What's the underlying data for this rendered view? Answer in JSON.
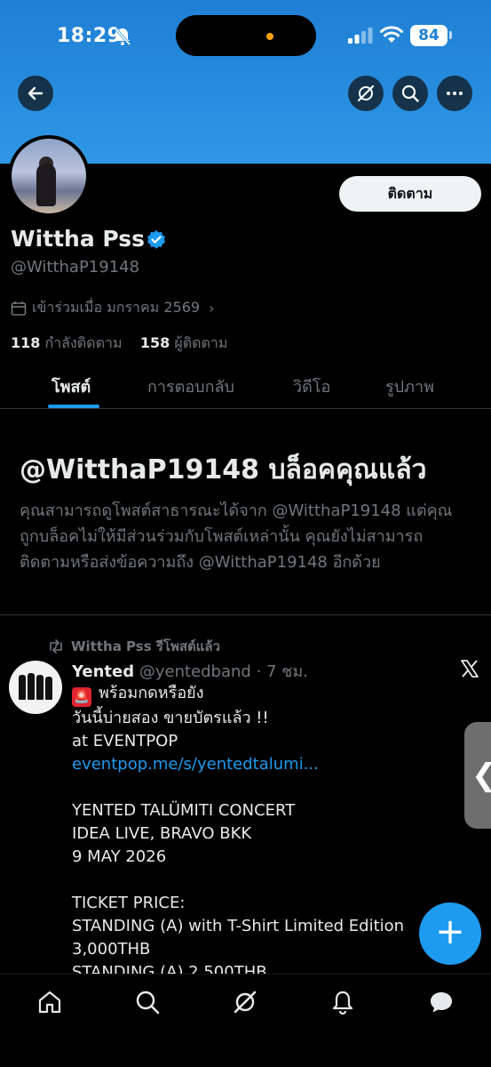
{
  "status_bar": {
    "time": "18:29",
    "battery": "84"
  },
  "profile": {
    "display_name": "Wittha Pss",
    "handle": "@WitthaP19148",
    "joined": "เข้าร่วมเมื่อ มกราคม 2569",
    "following_count": "118",
    "following_label": "กำลังติดตาม",
    "followers_count": "158",
    "followers_label": "ผู้ติดตาม",
    "follow_button": "ติดตาม"
  },
  "tabs": [
    {
      "label": "โพสต์",
      "active": true
    },
    {
      "label": "การตอบกลับ",
      "active": false
    },
    {
      "label": "วิดีโอ",
      "active": false
    },
    {
      "label": "รูปภาพ",
      "active": false
    }
  ],
  "blocked": {
    "title": "@WitthaP19148 บล็อคคุณแล้ว",
    "description": "คุณสามารถดูโพสต์สาธารณะได้จาก @WitthaP19148 แต่คุณถูกบล็อคไม่ให้มีส่วนร่วมกับโพสต์เหล่านั้น คุณยังไม่สามารถติดตามหรือส่งข้อความถึง @WitthaP19148 อีกด้วย"
  },
  "post": {
    "repost_label": "Wittha Pss รีโพสต์แล้ว",
    "author_name": "Yented",
    "author_handle": "@yentedband",
    "time": "· 7 ชม.",
    "lines": [
      "พร้อมกดหรือยัง",
      "วันนี้บ่ายสอง  ขายบัตรแล้ว !!",
      "at EVENTPOP",
      "eventpop.me/s/yentedtalumi...",
      "",
      "YENTED TALÜMITI CONCERT",
      "IDEA LIVE, BRAVO BKK",
      "9 MAY 2026",
      "",
      "TICKET PRICE:",
      "STANDING (A) with T-Shirt Limited Edition",
      "3,000THB",
      "STANDING (A) 2,500THB"
    ]
  },
  "fab_label": "+",
  "side_handle_label": "❮",
  "colors": {
    "accent": "#1d9bf0",
    "header": "#2e97e6",
    "background": "#000000",
    "muted_text": "#71767b"
  },
  "icons": {
    "back": "arrow-left-icon",
    "grok": "grok-icon",
    "search": "search-icon",
    "more": "more-icon",
    "nav": [
      "home-icon",
      "search-icon",
      "grok-icon",
      "bell-icon",
      "chat-icon"
    ]
  }
}
